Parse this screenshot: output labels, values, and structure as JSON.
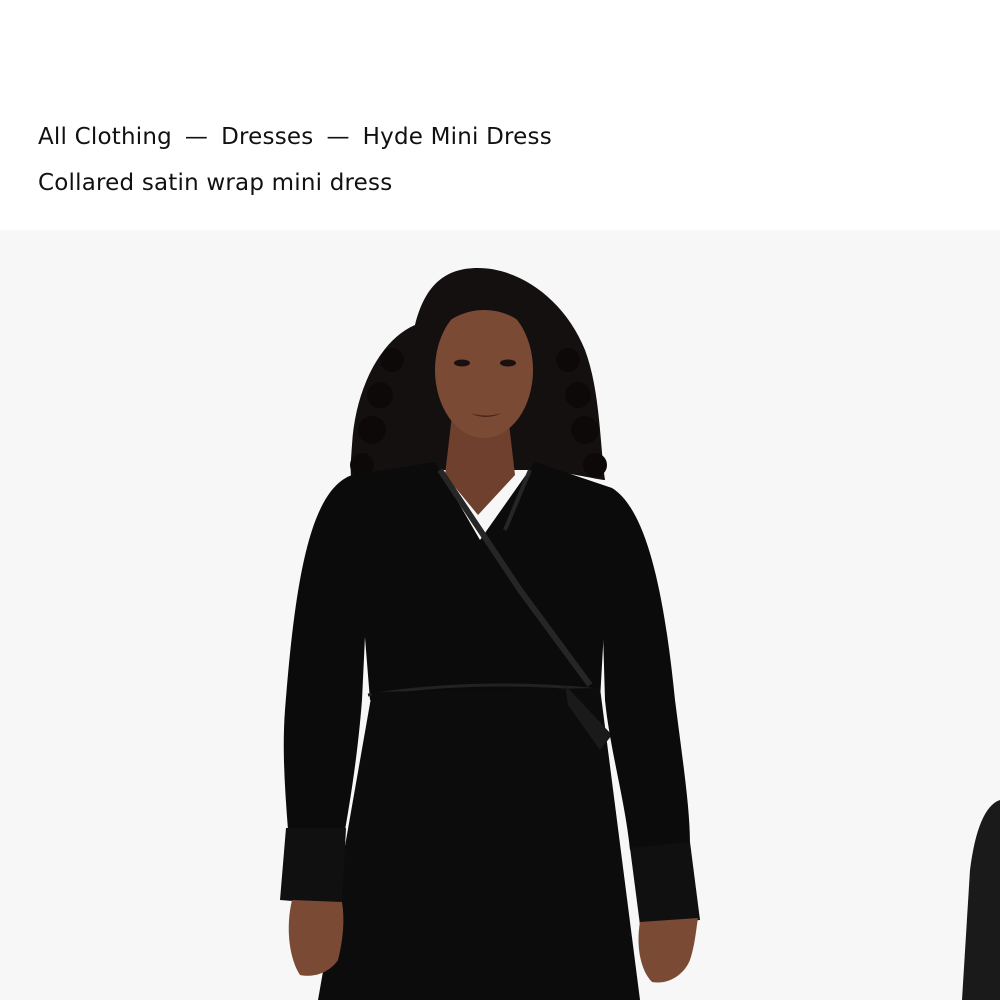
{
  "breadcrumb": {
    "items": [
      "All Clothing",
      "Dresses",
      "Hyde Mini Dress"
    ],
    "separator": "—"
  },
  "product": {
    "subtitle": "Collared satin wrap mini dress",
    "image_alt": "Model wearing black satin wrap mini dress with long balloon sleeves"
  },
  "colors": {
    "background": "#ffffff",
    "gallery_background": "#f7f7f7",
    "text": "#111111",
    "dress": "#0b0b0b",
    "skin": "#7a4a35",
    "hair": "#141010"
  }
}
